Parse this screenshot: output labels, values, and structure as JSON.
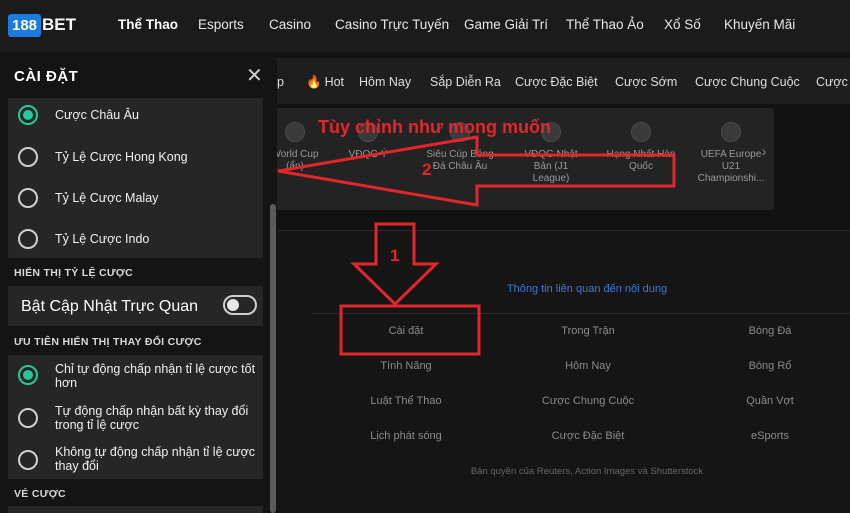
{
  "brand": {
    "logo_num": "188",
    "logo_word": "BET"
  },
  "topnav": [
    "Thể Thao",
    "Esports",
    "Casino",
    "Casino Trực Tuyến",
    "Game Giải Trí",
    "Thể Thao Ảo",
    "Xổ Số",
    "Khuyến Mãi"
  ],
  "subnav": [
    "p",
    "Hot",
    "Hôm Nay",
    "Sắp Diễn Ra",
    "Cược Đặc Biệt",
    "Cược Sớm",
    "Cược Chung Cuộc",
    "Cược"
  ],
  "leagues": [
    "World Cup\n(ẩn)",
    "VĐQG Ý",
    "Siêu Cúp Bóng\nĐá Châu Âu",
    "VĐQG Nhật\nBản (J1\nLeague)",
    "Hạng Nhất Hàn\nQuốc",
    "UEFA Europe\nU21\nChampionshi..."
  ],
  "settings": {
    "title": "CÀI ĐẶT",
    "odds_options": [
      "Cược Châu Âu",
      "Tỷ Lệ Cược Hong Kong",
      "Tỷ Lệ Cược Malay",
      "Tỷ Lệ Cược Indo"
    ],
    "odds_selected": 0,
    "section_display": "HIỂN THỊ TỶ LỆ CƯỢC",
    "visual_update_label": "Bật Cập Nhật Trực Quan",
    "visual_update_on": false,
    "section_priority": "ƯU TIÊN HIỂN THỊ THAY ĐỔI CƯỢC",
    "priority_options": [
      "Chỉ tự động chấp nhận tỉ lệ cược tốt hơn",
      "Tự động chấp nhận bất kỳ thay đổi trong tỉ lệ cược",
      "Không tự động chấp nhận tỉ lệ cược thay đổi"
    ],
    "priority_selected": 0,
    "section_bet": "VÉ CƯỢC"
  },
  "footer": {
    "info": "Thông tin liên quan đến nội dung",
    "links": [
      "Cài đặt",
      "Trong Trận",
      "Bóng Đá",
      "Tính Năng",
      "Hôm Nay",
      "Bóng Rổ",
      "Luật Thể Thao",
      "Cược Chung Cuộc",
      "Quần Vợt",
      "Lịch phát sóng",
      "Cược Đặc Biệt",
      "eSports"
    ],
    "copyright": "Bản quyền của Reuters, Action Images và Shutterstock"
  },
  "annotations": {
    "caption": "Tùy chỉnh như mong muốn",
    "step1": "1",
    "step2": "2",
    "color": "#e2262b"
  }
}
